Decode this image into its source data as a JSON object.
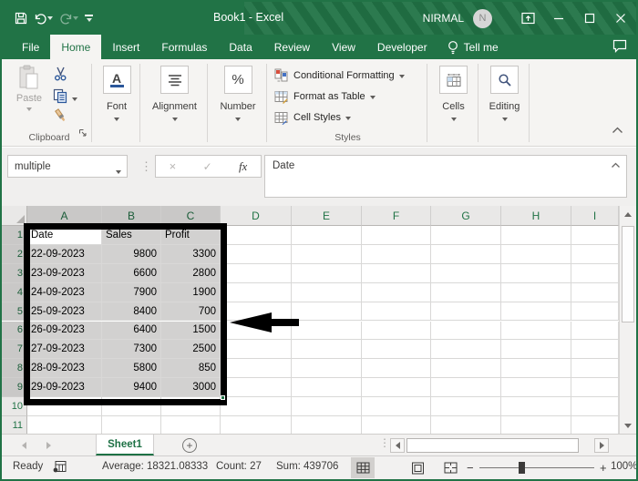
{
  "titlebar": {
    "title": "Book1 - Excel",
    "user": "NIRMAL",
    "avatar_initial": "N"
  },
  "tabs": {
    "items": [
      "File",
      "Home",
      "Insert",
      "Formulas",
      "Data",
      "Review",
      "View",
      "Developer"
    ],
    "active": "Home",
    "tell_me": "Tell me"
  },
  "ribbon": {
    "clipboard": {
      "label": "Clipboard",
      "paste": "Paste"
    },
    "font": {
      "label": "Font"
    },
    "alignment": {
      "label": "Alignment"
    },
    "number": {
      "label": "Number",
      "percent_glyph": "%"
    },
    "styles": {
      "label": "Styles",
      "items": [
        "Conditional Formatting",
        "Format as Table",
        "Cell Styles"
      ]
    },
    "cells": {
      "label": "Cells"
    },
    "editing": {
      "label": "Editing"
    },
    "font_glyph": "A"
  },
  "formula_bar": {
    "name_box": "multiple",
    "content": "Date",
    "fx_glyph": "fx",
    "cancel_glyph": "×",
    "enter_glyph": "✓"
  },
  "grid": {
    "columns": [
      "A",
      "B",
      "C",
      "D",
      "E",
      "F",
      "G",
      "H",
      "I"
    ],
    "selection": {
      "range": "A1:C9",
      "selected_col_count": 3,
      "selected_row_count": 9,
      "active_cell": "A1"
    },
    "data": [
      [
        "Date",
        "Sales",
        "Profit"
      ],
      [
        "22-09-2023",
        "9800",
        "3300"
      ],
      [
        "23-09-2023",
        "6600",
        "2800"
      ],
      [
        "24-09-2023",
        "7900",
        "1900"
      ],
      [
        "25-09-2023",
        "8400",
        "700"
      ],
      [
        "26-09-2023",
        "6400",
        "1500"
      ],
      [
        "27-09-2023",
        "7300",
        "2500"
      ],
      [
        "28-09-2023",
        "5800",
        "850"
      ],
      [
        "29-09-2023",
        "9400",
        "3000"
      ]
    ]
  },
  "sheet_bar": {
    "tab": "Sheet1",
    "new_sheet_glyph": "+"
  },
  "status_bar": {
    "mode": "Ready",
    "average": "Average: 18321.08333",
    "count": "Count: 27",
    "sum": "Sum: 439706",
    "zoom_out_glyph": "−",
    "zoom_in_glyph": "+",
    "zoom_level": "100%"
  },
  "colors": {
    "excel_green": "#217346",
    "selection_fill": "#d2d1d0",
    "annotation_black": "#000000"
  }
}
